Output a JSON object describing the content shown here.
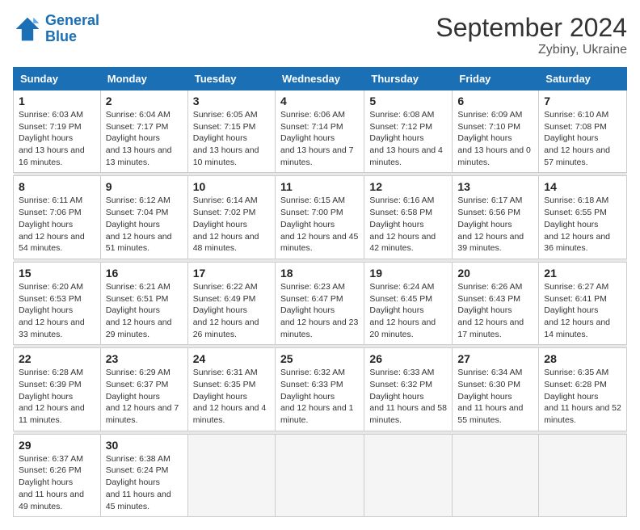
{
  "logo": {
    "line1": "General",
    "line2": "Blue"
  },
  "title": "September 2024",
  "location": "Zybiny, Ukraine",
  "days_of_week": [
    "Sunday",
    "Monday",
    "Tuesday",
    "Wednesday",
    "Thursday",
    "Friday",
    "Saturday"
  ],
  "weeks": [
    [
      {
        "day": "1",
        "sunrise": "6:03 AM",
        "sunset": "7:19 PM",
        "daylight": "13 hours and 16 minutes."
      },
      {
        "day": "2",
        "sunrise": "6:04 AM",
        "sunset": "7:17 PM",
        "daylight": "13 hours and 13 minutes."
      },
      {
        "day": "3",
        "sunrise": "6:05 AM",
        "sunset": "7:15 PM",
        "daylight": "13 hours and 10 minutes."
      },
      {
        "day": "4",
        "sunrise": "6:06 AM",
        "sunset": "7:14 PM",
        "daylight": "13 hours and 7 minutes."
      },
      {
        "day": "5",
        "sunrise": "6:08 AM",
        "sunset": "7:12 PM",
        "daylight": "13 hours and 4 minutes."
      },
      {
        "day": "6",
        "sunrise": "6:09 AM",
        "sunset": "7:10 PM",
        "daylight": "13 hours and 0 minutes."
      },
      {
        "day": "7",
        "sunrise": "6:10 AM",
        "sunset": "7:08 PM",
        "daylight": "12 hours and 57 minutes."
      }
    ],
    [
      {
        "day": "8",
        "sunrise": "6:11 AM",
        "sunset": "7:06 PM",
        "daylight": "12 hours and 54 minutes."
      },
      {
        "day": "9",
        "sunrise": "6:12 AM",
        "sunset": "7:04 PM",
        "daylight": "12 hours and 51 minutes."
      },
      {
        "day": "10",
        "sunrise": "6:14 AM",
        "sunset": "7:02 PM",
        "daylight": "12 hours and 48 minutes."
      },
      {
        "day": "11",
        "sunrise": "6:15 AM",
        "sunset": "7:00 PM",
        "daylight": "12 hours and 45 minutes."
      },
      {
        "day": "12",
        "sunrise": "6:16 AM",
        "sunset": "6:58 PM",
        "daylight": "12 hours and 42 minutes."
      },
      {
        "day": "13",
        "sunrise": "6:17 AM",
        "sunset": "6:56 PM",
        "daylight": "12 hours and 39 minutes."
      },
      {
        "day": "14",
        "sunrise": "6:18 AM",
        "sunset": "6:55 PM",
        "daylight": "12 hours and 36 minutes."
      }
    ],
    [
      {
        "day": "15",
        "sunrise": "6:20 AM",
        "sunset": "6:53 PM",
        "daylight": "12 hours and 33 minutes."
      },
      {
        "day": "16",
        "sunrise": "6:21 AM",
        "sunset": "6:51 PM",
        "daylight": "12 hours and 29 minutes."
      },
      {
        "day": "17",
        "sunrise": "6:22 AM",
        "sunset": "6:49 PM",
        "daylight": "12 hours and 26 minutes."
      },
      {
        "day": "18",
        "sunrise": "6:23 AM",
        "sunset": "6:47 PM",
        "daylight": "12 hours and 23 minutes."
      },
      {
        "day": "19",
        "sunrise": "6:24 AM",
        "sunset": "6:45 PM",
        "daylight": "12 hours and 20 minutes."
      },
      {
        "day": "20",
        "sunrise": "6:26 AM",
        "sunset": "6:43 PM",
        "daylight": "12 hours and 17 minutes."
      },
      {
        "day": "21",
        "sunrise": "6:27 AM",
        "sunset": "6:41 PM",
        "daylight": "12 hours and 14 minutes."
      }
    ],
    [
      {
        "day": "22",
        "sunrise": "6:28 AM",
        "sunset": "6:39 PM",
        "daylight": "12 hours and 11 minutes."
      },
      {
        "day": "23",
        "sunrise": "6:29 AM",
        "sunset": "6:37 PM",
        "daylight": "12 hours and 7 minutes."
      },
      {
        "day": "24",
        "sunrise": "6:31 AM",
        "sunset": "6:35 PM",
        "daylight": "12 hours and 4 minutes."
      },
      {
        "day": "25",
        "sunrise": "6:32 AM",
        "sunset": "6:33 PM",
        "daylight": "12 hours and 1 minute."
      },
      {
        "day": "26",
        "sunrise": "6:33 AM",
        "sunset": "6:32 PM",
        "daylight": "11 hours and 58 minutes."
      },
      {
        "day": "27",
        "sunrise": "6:34 AM",
        "sunset": "6:30 PM",
        "daylight": "11 hours and 55 minutes."
      },
      {
        "day": "28",
        "sunrise": "6:35 AM",
        "sunset": "6:28 PM",
        "daylight": "11 hours and 52 minutes."
      }
    ],
    [
      {
        "day": "29",
        "sunrise": "6:37 AM",
        "sunset": "6:26 PM",
        "daylight": "11 hours and 49 minutes."
      },
      {
        "day": "30",
        "sunrise": "6:38 AM",
        "sunset": "6:24 PM",
        "daylight": "11 hours and 45 minutes."
      },
      null,
      null,
      null,
      null,
      null
    ]
  ]
}
